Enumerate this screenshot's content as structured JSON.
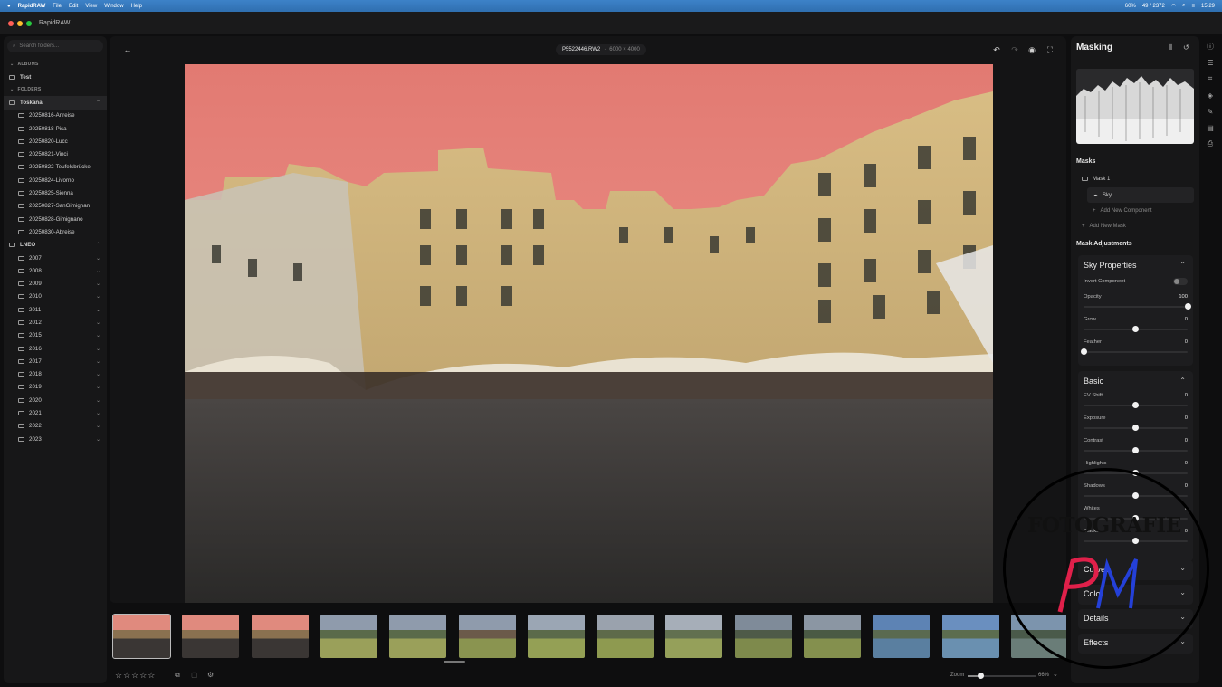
{
  "menubar": {
    "apple": "",
    "app": "RapidRAW",
    "menus": [
      "File",
      "Edit",
      "View",
      "Window",
      "Help"
    ],
    "status": {
      "battery": "60%",
      "counter": "49 / 2372",
      "clock": "15:29"
    }
  },
  "window": {
    "title": "RapidRAW"
  },
  "sidebar": {
    "search_placeholder": "Search folders...",
    "albums_label": "ALBUMS",
    "albums": [
      "Test"
    ],
    "folders_label": "FOLDERS",
    "root": "Toskana",
    "toskana_children": [
      "20250816-Anreise",
      "20250818-Pisa",
      "20250820-Lucc",
      "20250821-Vinci",
      "20250822-Teufelsbrücke",
      "20250824-Livorno",
      "20250825-Sienna",
      "20250827-SanGimignan",
      "20250828-Gimignano",
      "20250830-Abreise"
    ],
    "root2": "LNEO",
    "years": [
      "2007",
      "2008",
      "2009",
      "2010",
      "2011",
      "2012",
      "2015",
      "2016",
      "2017",
      "2018",
      "2019",
      "2020",
      "2021",
      "2022",
      "2023"
    ]
  },
  "viewer": {
    "filename": "P5522446.RW2",
    "dimensions": "6000 × 4000"
  },
  "bottombar": {
    "zoom_label": "Zoom",
    "zoom_value": "66%",
    "rating_stars": 5
  },
  "right_panel": {
    "title": "Masking",
    "masks_label": "Masks",
    "mask_name": "Mask 1",
    "component": "Sky",
    "add_component": "Add New Component",
    "add_mask": "Add New Mask",
    "adjust_label": "Mask Adjustments",
    "sky_title": "Sky Properties",
    "invert_label": "Invert Component",
    "sky_sliders": [
      {
        "name": "Opacity",
        "value": "100",
        "level": 1.0
      },
      {
        "name": "Grow",
        "value": "0",
        "level": 0.5
      },
      {
        "name": "Feather",
        "value": "0",
        "level": 0.0
      }
    ],
    "basic_title": "Basic",
    "basic_sliders": [
      {
        "name": "EV Shift",
        "value": "0",
        "level": 0.5
      },
      {
        "name": "Exposure",
        "value": "0",
        "level": 0.5
      },
      {
        "name": "Contrast",
        "value": "0",
        "level": 0.5
      },
      {
        "name": "Highlights",
        "value": "0",
        "level": 0.5
      },
      {
        "name": "Shadows",
        "value": "0",
        "level": 0.5
      },
      {
        "name": "Whites",
        "value": "0",
        "level": 0.5
      },
      {
        "name": "Blacks",
        "value": "0",
        "level": 0.5
      }
    ],
    "collapsed_sections": [
      "Curves",
      "Color",
      "Details",
      "Effects"
    ]
  },
  "watermark": {
    "text": "FOTOGRAFIE",
    "monogram": "PM"
  }
}
